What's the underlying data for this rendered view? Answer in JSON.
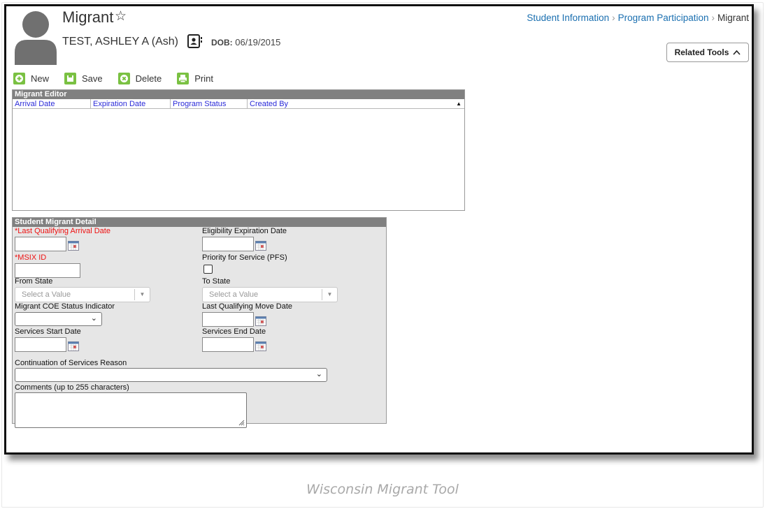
{
  "header": {
    "page_title": "Migrant",
    "student_name": "TEST, ASHLEY A (Ash)",
    "dob_label": "DOB:",
    "dob_value": "06/19/2015"
  },
  "breadcrumb": [
    "Student Information",
    "Program Participation",
    "Migrant"
  ],
  "related_tools_label": "Related Tools",
  "toolbar": {
    "new_label": "New",
    "save_label": "Save",
    "delete_label": "Delete",
    "print_label": "Print"
  },
  "editor": {
    "title": "Migrant Editor",
    "columns": [
      "Arrival Date",
      "Expiration Date",
      "Program Status",
      "Created By"
    ]
  },
  "detail": {
    "title": "Student Migrant Detail",
    "last_arrival_label": "*Last Qualifying Arrival Date",
    "eligibility_label": "Eligibility Expiration Date",
    "msix_label": "*MSIX ID",
    "pfs_label": "Priority for Service (PFS)",
    "from_state_label": "From State",
    "to_state_label": "To State",
    "from_state_placeholder": "Select a Value",
    "to_state_placeholder": "Select a Value",
    "coe_label": "Migrant COE Status Indicator",
    "last_move_label": "Last Qualifying Move Date",
    "services_start_label": "Services Start Date",
    "services_end_label": "Services End Date",
    "continuation_label": "Continuation of Services Reason",
    "comments_label": "Comments (up to 255 characters)"
  },
  "caption": "Wisconsin Migrant Tool",
  "colors": {
    "link": "#1a6fb0",
    "toolbar_green": "#7ac142",
    "required_red": "#ee1111",
    "panel_header": "#808080",
    "column_link": "#2a2ad8"
  }
}
